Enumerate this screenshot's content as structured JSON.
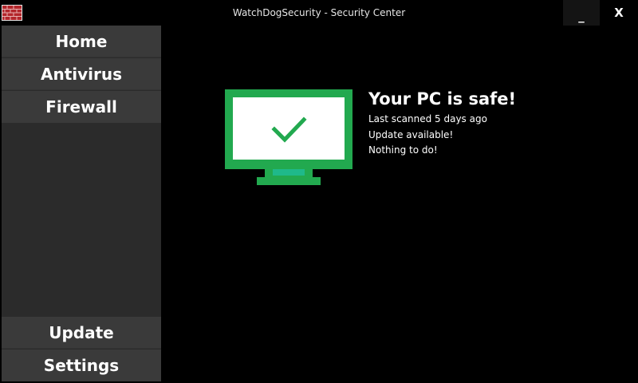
{
  "window": {
    "title": "WatchDogSecurity - Security Center",
    "minimize_label": "_",
    "close_label": "X"
  },
  "sidebar": {
    "top_items": [
      {
        "label": "Home"
      },
      {
        "label": "Antivirus"
      },
      {
        "label": "Firewall"
      }
    ],
    "bottom_items": [
      {
        "label": "Update"
      },
      {
        "label": "Settings"
      }
    ]
  },
  "status": {
    "headline": "Your PC is safe!",
    "lines": [
      "Last scanned 5 days ago",
      "Update available!",
      "Nothing to do!"
    ],
    "icon": "monitor-check-icon",
    "accent_color": "#22a94f"
  },
  "colors": {
    "background": "#000000",
    "sidebar": "#2b2b2b",
    "nav_item": "#3a3a3a",
    "app_icon": "#b3262b"
  }
}
